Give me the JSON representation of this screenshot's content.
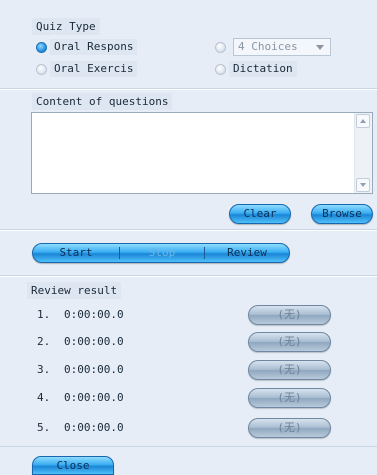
{
  "quiz_type": {
    "title": "Quiz Type",
    "options": [
      {
        "label": "Oral Respons",
        "checked": true
      },
      {
        "label": "Oral Exercis",
        "checked": false
      },
      {
        "label": "",
        "checked": false
      },
      {
        "label": "Dictation",
        "checked": false
      }
    ],
    "choices_select": {
      "value": "4 Choices"
    }
  },
  "content": {
    "title": "Content of questions",
    "clear_label": "Clear",
    "browse_label": "Browse"
  },
  "controls": {
    "start_label": "Start",
    "stop_label": "Stop",
    "review_label": "Review"
  },
  "review": {
    "title": "Review result",
    "rows": [
      {
        "num": "1.",
        "time": "0:00:00.0",
        "button": "(无)"
      },
      {
        "num": "2.",
        "time": "0:00:00.0",
        "button": "(无)"
      },
      {
        "num": "3.",
        "time": "0:00:00.0",
        "button": "(无)"
      },
      {
        "num": "4.",
        "time": "0:00:00.0",
        "button": "(无)"
      },
      {
        "num": "5.",
        "time": "0:00:00.0",
        "button": "(无)"
      }
    ]
  },
  "footer": {
    "close_label": "Close"
  },
  "colors": {
    "accent_blue": "#2d9ae8",
    "panel_bg": "#e9eff7",
    "disabled_gray": "#8fa7bf"
  }
}
